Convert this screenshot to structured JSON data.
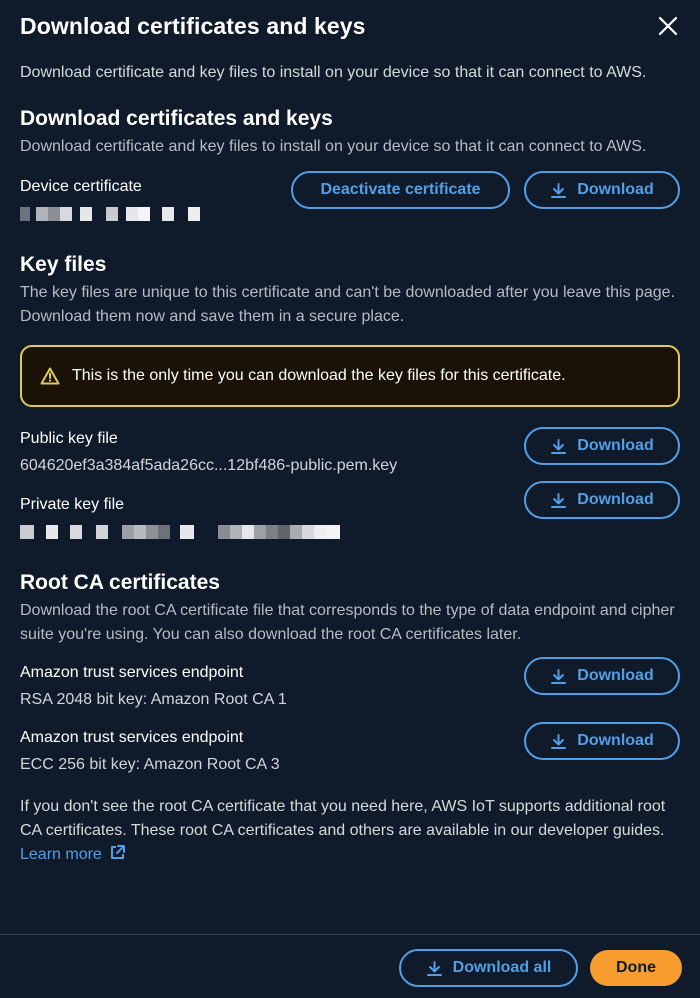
{
  "modal": {
    "title": "Download certificates and keys",
    "intro": "Download certificate and key files to install on your device so that it can connect to AWS."
  },
  "certs": {
    "heading": "Download certificates and keys",
    "description": "Download certificate and key files to install on your device so that it can connect to AWS.",
    "device_cert_label": "Device certificate",
    "deactivate_label": "Deactivate certificate",
    "download_label": "Download"
  },
  "keys": {
    "heading": "Key files",
    "description": "The key files are unique to this certificate and can't be downloaded after you leave this page. Download them now and save them in a secure place.",
    "warning": "This is the only time you can download the key files for this certificate.",
    "public_label": "Public key file",
    "public_value": "604620ef3a384af5ada26cc...12bf486-public.pem.key",
    "private_label": "Private key file",
    "download_label": "Download"
  },
  "root_ca": {
    "heading": "Root CA certificates",
    "description": "Download the root CA certificate file that corresponds to the type of data endpoint and cipher suite you're using. You can also download the root CA certificates later.",
    "items": [
      {
        "label": "Amazon trust services endpoint",
        "value": "RSA 2048 bit key: Amazon Root CA 1"
      },
      {
        "label": "Amazon trust services endpoint",
        "value": "ECC 256 bit key: Amazon Root CA 3"
      }
    ],
    "download_label": "Download",
    "footer_text": "If you don't see the root CA certificate that you need here, AWS IoT supports additional root CA certificates. These root CA certificates and others are available in our developer guides.",
    "learn_more": "Learn more"
  },
  "footer": {
    "download_all": "Download all",
    "done": "Done"
  },
  "colors": {
    "background": "#0f1b2a",
    "link": "#539fe5",
    "warning_border": "#e0ca57",
    "primary": "#f89c30"
  },
  "icons": [
    "close-icon",
    "download-icon",
    "warning-icon",
    "external-link-icon"
  ]
}
